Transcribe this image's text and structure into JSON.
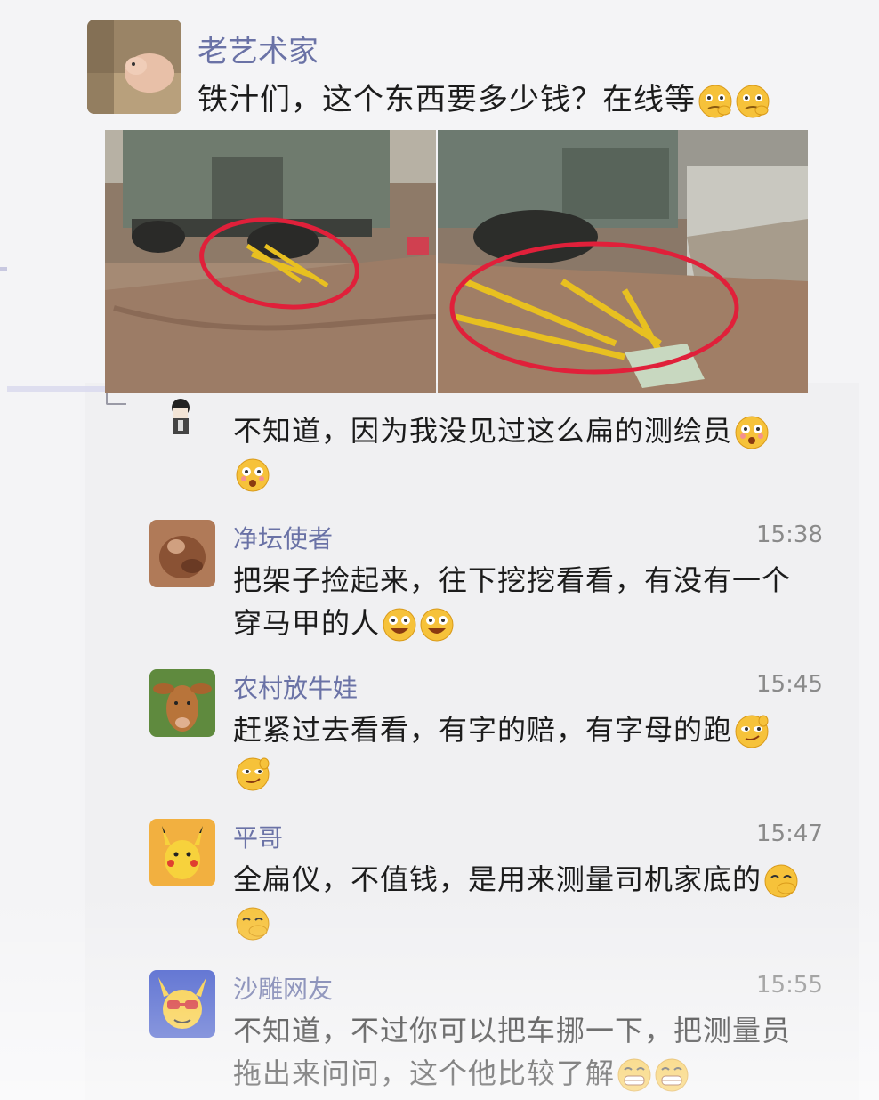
{
  "post": {
    "author": "老艺术家",
    "text": "铁汁们，这个东西要多少钱？在线等",
    "emoji": "thinking-emoji"
  },
  "comments": [
    {
      "name": "",
      "time": "",
      "lines": [
        "不知道，因为我没见过这么扁的测绘员"
      ],
      "emoji": "surprised-emoji"
    },
    {
      "name": "净坛使者",
      "time": "15:38",
      "lines": [
        "把架子捡起来，往下挖挖看看，有没有一个",
        "穿马甲的人"
      ],
      "emoji": "laughing-emoji"
    },
    {
      "name": "农村放牛娃",
      "time": "15:45",
      "lines": [
        "赶紧过去看看，有字的赔，有字母的跑"
      ],
      "emoji": "smirk-emoji"
    },
    {
      "name": "平哥",
      "time": "15:47",
      "lines": [
        "全扁仪，不值钱，是用来测量司机家底的"
      ],
      "emoji": "shy-emoji"
    },
    {
      "name": "沙雕网友",
      "time": "15:55",
      "lines": [
        "不知道，不过你可以把车挪一下，把测量员",
        "拖出来问问，这个他比较了解"
      ],
      "emoji": "grin-emoji"
    }
  ],
  "colors": {
    "name": "#6a72a6",
    "time": "#8a8a8a",
    "annotation": "#e0203a",
    "rod": "#e8c020"
  }
}
